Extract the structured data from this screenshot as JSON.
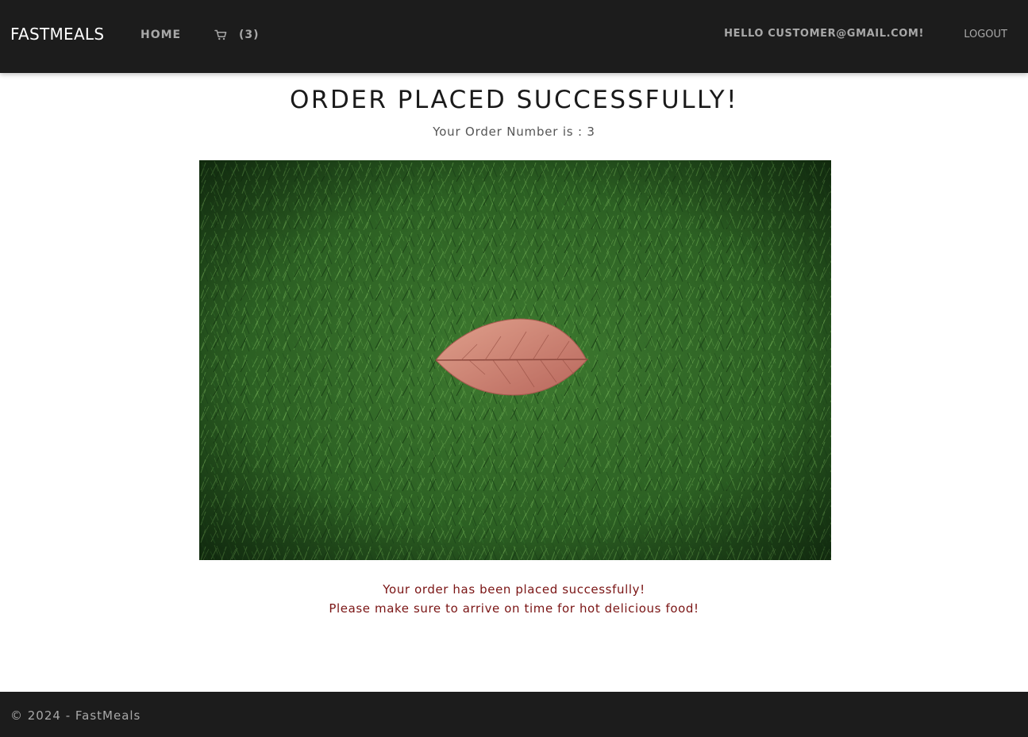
{
  "navbar": {
    "brand": "FASTMEALS",
    "home_label": "HOME",
    "cart_icon": "cart-icon",
    "cart_count": "(3)",
    "greeting": "HELLO CUSTOMER@GMAIL.COM!",
    "logout_label": "LOGOUT",
    "background_color": "#1c1c1c"
  },
  "main": {
    "title": "ORDER PLACED SUCCESSFULLY!",
    "order_number_text": "Your Order Number is : 3",
    "image": "grass-with-leaf-photo",
    "message_line1": "Your order has been placed successfully!",
    "message_line2": "Please make sure to arrive on time for hot delicious food!",
    "message_color": "#7a1414"
  },
  "footer": {
    "text": "© 2024 - FastMeals"
  }
}
